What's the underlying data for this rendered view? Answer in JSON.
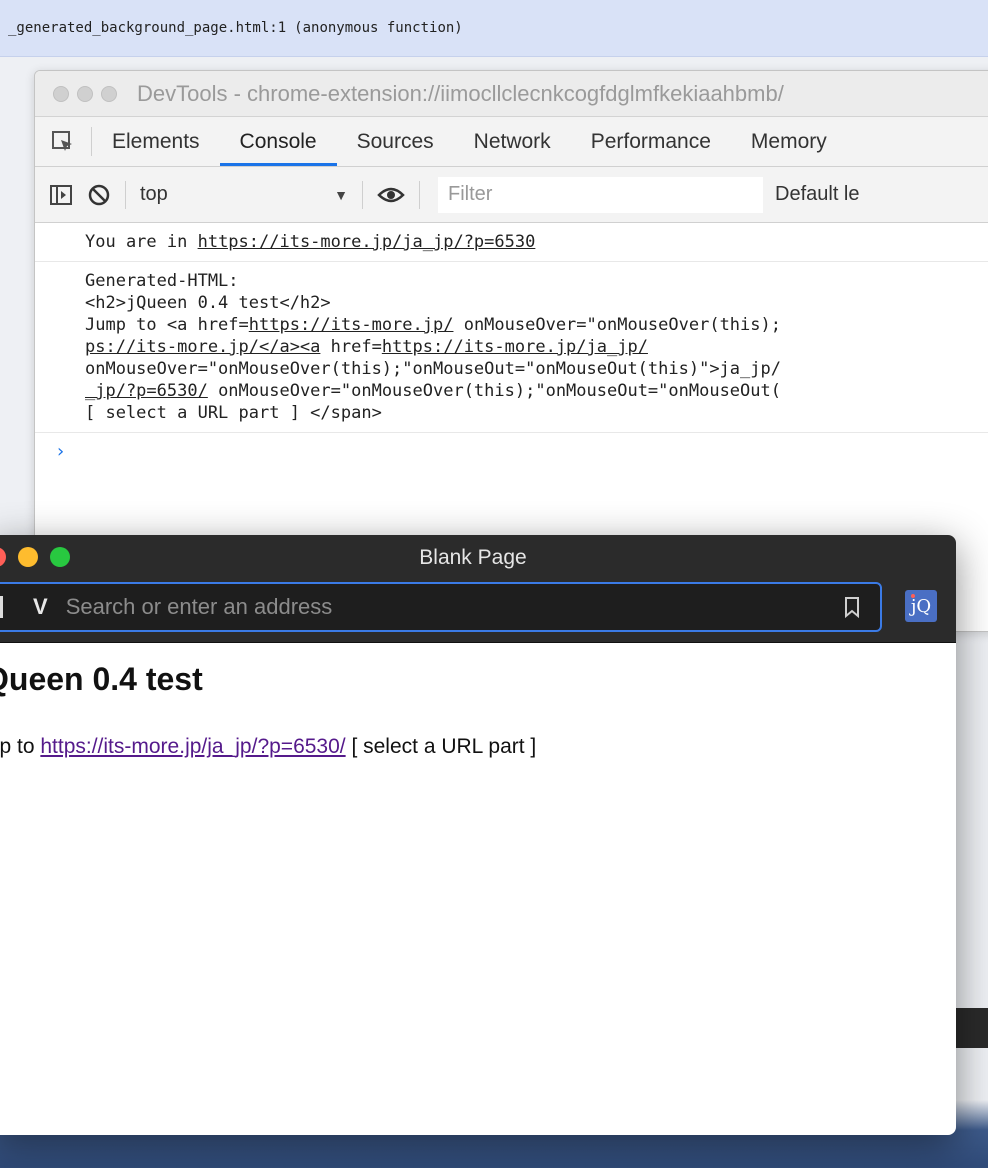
{
  "banner": {
    "file": "_generated_background_page.html:1",
    "func": "(anonymous function)"
  },
  "devtools": {
    "title": "DevTools - chrome-extension://iimocllclecnkcogfdglmfkekiaahbmb/",
    "tabs": [
      "Elements",
      "Console",
      "Sources",
      "Network",
      "Performance",
      "Memory"
    ],
    "active_tab": "Console",
    "context": "top",
    "filter_placeholder": "Filter",
    "levels": "Default le",
    "messages": {
      "m1_prefix": "You are in ",
      "m1_link": "https://its-more.jp/ja_jp/?p=6530",
      "m2_l1": "Generated-HTML:",
      "m2_l2": "<h2>jQueen 0.4 test</h2>",
      "m2_l3a": "Jump to <a href=",
      "m2_l3b": "https://its-more.jp/",
      "m2_l3c": " onMouseOver=\"onMouseOver(this);",
      "m2_l4a": "ps://its-more.jp/</a><a",
      "m2_l4b": " href=",
      "m2_l4c": "https://its-more.jp/ja_jp/",
      "m2_l5": "onMouseOver=\"onMouseOver(this);\"onMouseOut=\"onMouseOut(this)\">ja_jp/",
      "m2_l6a": "_jp/?p=6530/",
      "m2_l6b": " onMouseOver=\"onMouseOver(this);\"onMouseOut=\"onMouseOut(",
      "m2_l7": "[ select a URL part ] </span>"
    },
    "prompt": "›"
  },
  "browser": {
    "title": "Blank Page",
    "address_placeholder": "Search or enter an address",
    "address_v": "V",
    "ext_label": "jQ",
    "page": {
      "heading": "Queen 0.4 test",
      "line_prefix": "mp to ",
      "link": "https://its-more.jp/ja_jp/?p=6530/",
      "line_suffix": " [ select a URL part ]"
    }
  }
}
